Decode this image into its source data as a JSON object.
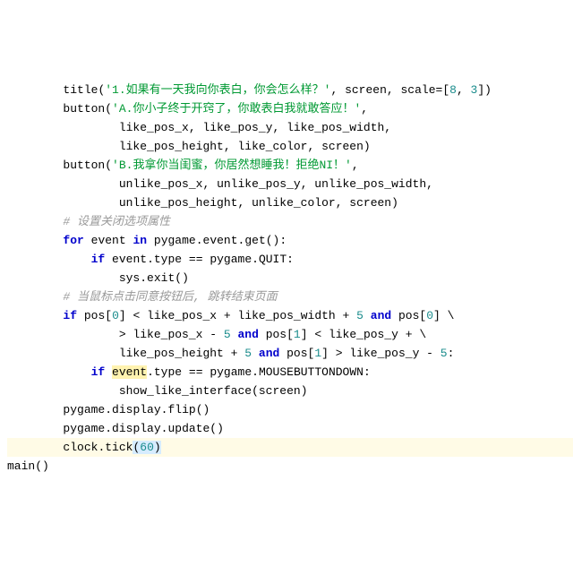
{
  "indent": "    ",
  "lines": [
    {
      "lvl": 2,
      "segs": [
        {
          "t": "fn",
          "v": "title"
        },
        {
          "t": "op",
          "v": "("
        },
        {
          "t": "str",
          "v": "'1.如果有一天我向你表白，你会怎么样？'"
        },
        {
          "t": "op",
          "v": ", "
        },
        {
          "t": "fn",
          "v": "screen"
        },
        {
          "t": "op",
          "v": ", "
        },
        {
          "t": "fn",
          "v": "scale"
        },
        {
          "t": "op",
          "v": "=["
        },
        {
          "t": "num",
          "v": "8"
        },
        {
          "t": "op",
          "v": ", "
        },
        {
          "t": "num",
          "v": "3"
        },
        {
          "t": "op",
          "v": "])"
        }
      ]
    },
    {
      "lvl": 2,
      "segs": [
        {
          "t": "fn",
          "v": "button"
        },
        {
          "t": "op",
          "v": "("
        },
        {
          "t": "str",
          "v": "'A.你小子终于开窍了，你敢表白我就敢答应！'"
        },
        {
          "t": "op",
          "v": ","
        }
      ]
    },
    {
      "lvl": 4,
      "segs": [
        {
          "t": "fn",
          "v": "like_pos_x"
        },
        {
          "t": "op",
          "v": ", "
        },
        {
          "t": "fn",
          "v": "like_pos_y"
        },
        {
          "t": "op",
          "v": ", "
        },
        {
          "t": "fn",
          "v": "like_pos_width"
        },
        {
          "t": "op",
          "v": ","
        }
      ]
    },
    {
      "lvl": 4,
      "segs": [
        {
          "t": "fn",
          "v": "like_pos_height"
        },
        {
          "t": "op",
          "v": ", "
        },
        {
          "t": "fn",
          "v": "like_color"
        },
        {
          "t": "op",
          "v": ", "
        },
        {
          "t": "fn",
          "v": "screen"
        },
        {
          "t": "op",
          "v": ")"
        }
      ]
    },
    {
      "lvl": 2,
      "segs": [
        {
          "t": "fn",
          "v": "button"
        },
        {
          "t": "op",
          "v": "("
        },
        {
          "t": "str",
          "v": "'B.我拿你当闺蜜，你居然想睡我！拒绝NI！'"
        },
        {
          "t": "op",
          "v": ","
        }
      ]
    },
    {
      "lvl": 4,
      "segs": [
        {
          "t": "fn",
          "v": "unlike_pos_x"
        },
        {
          "t": "op",
          "v": ", "
        },
        {
          "t": "fn",
          "v": "unlike_pos_y"
        },
        {
          "t": "op",
          "v": ", "
        },
        {
          "t": "fn",
          "v": "unlike_pos_width"
        },
        {
          "t": "op",
          "v": ","
        }
      ]
    },
    {
      "lvl": 4,
      "segs": [
        {
          "t": "fn",
          "v": "unlike_pos_height"
        },
        {
          "t": "op",
          "v": ", "
        },
        {
          "t": "fn",
          "v": "unlike_color"
        },
        {
          "t": "op",
          "v": ", "
        },
        {
          "t": "fn",
          "v": "screen"
        },
        {
          "t": "op",
          "v": ")"
        }
      ]
    },
    {
      "lvl": 2,
      "segs": [
        {
          "t": "comm",
          "v": "# 设置关闭选项属性"
        }
      ]
    },
    {
      "lvl": 2,
      "segs": [
        {
          "t": "kw",
          "v": "for"
        },
        {
          "t": "op",
          "v": " "
        },
        {
          "t": "fn",
          "v": "event"
        },
        {
          "t": "op",
          "v": " "
        },
        {
          "t": "kw",
          "v": "in"
        },
        {
          "t": "op",
          "v": " "
        },
        {
          "t": "fn",
          "v": "pygame"
        },
        {
          "t": "op",
          "v": "."
        },
        {
          "t": "fn",
          "v": "event"
        },
        {
          "t": "op",
          "v": "."
        },
        {
          "t": "fn",
          "v": "get"
        },
        {
          "t": "op",
          "v": "():"
        }
      ]
    },
    {
      "lvl": 3,
      "segs": [
        {
          "t": "kw",
          "v": "if"
        },
        {
          "t": "op",
          "v": " "
        },
        {
          "t": "fn",
          "v": "event"
        },
        {
          "t": "op",
          "v": "."
        },
        {
          "t": "fn",
          "v": "type"
        },
        {
          "t": "op",
          "v": " == "
        },
        {
          "t": "fn",
          "v": "pygame"
        },
        {
          "t": "op",
          "v": "."
        },
        {
          "t": "fn",
          "v": "QUIT"
        },
        {
          "t": "op",
          "v": ":"
        }
      ]
    },
    {
      "lvl": 4,
      "segs": [
        {
          "t": "fn",
          "v": "sys"
        },
        {
          "t": "op",
          "v": "."
        },
        {
          "t": "fn",
          "v": "exit"
        },
        {
          "t": "op",
          "v": "()"
        }
      ]
    },
    {
      "lvl": 2,
      "segs": [
        {
          "t": "comm",
          "v": "# 当鼠标点击同意按钮后, 跳转结束页面"
        }
      ]
    },
    {
      "lvl": 2,
      "segs": [
        {
          "t": "kw",
          "v": "if"
        },
        {
          "t": "op",
          "v": " "
        },
        {
          "t": "fn",
          "v": "pos"
        },
        {
          "t": "op",
          "v": "["
        },
        {
          "t": "num",
          "v": "0"
        },
        {
          "t": "op",
          "v": "] < "
        },
        {
          "t": "fn",
          "v": "like_pos_x"
        },
        {
          "t": "op",
          "v": " + "
        },
        {
          "t": "fn",
          "v": "like_pos_width"
        },
        {
          "t": "op",
          "v": " + "
        },
        {
          "t": "num",
          "v": "5"
        },
        {
          "t": "op",
          "v": " "
        },
        {
          "t": "kw",
          "v": "and"
        },
        {
          "t": "op",
          "v": " "
        },
        {
          "t": "fn",
          "v": "pos"
        },
        {
          "t": "op",
          "v": "["
        },
        {
          "t": "num",
          "v": "0"
        },
        {
          "t": "op",
          "v": "] \\"
        }
      ]
    },
    {
      "lvl": 4,
      "segs": [
        {
          "t": "op",
          "v": "> "
        },
        {
          "t": "fn",
          "v": "like_pos_x"
        },
        {
          "t": "op",
          "v": " - "
        },
        {
          "t": "num",
          "v": "5"
        },
        {
          "t": "op",
          "v": " "
        },
        {
          "t": "kw",
          "v": "and"
        },
        {
          "t": "op",
          "v": " "
        },
        {
          "t": "fn",
          "v": "pos"
        },
        {
          "t": "op",
          "v": "["
        },
        {
          "t": "num",
          "v": "1"
        },
        {
          "t": "op",
          "v": "] < "
        },
        {
          "t": "fn",
          "v": "like_pos_y"
        },
        {
          "t": "op",
          "v": " + \\"
        }
      ]
    },
    {
      "lvl": 4,
      "segs": [
        {
          "t": "fn",
          "v": "like_pos_height"
        },
        {
          "t": "op",
          "v": " + "
        },
        {
          "t": "num",
          "v": "5"
        },
        {
          "t": "op",
          "v": " "
        },
        {
          "t": "kw",
          "v": "and"
        },
        {
          "t": "op",
          "v": " "
        },
        {
          "t": "fn",
          "v": "pos"
        },
        {
          "t": "op",
          "v": "["
        },
        {
          "t": "num",
          "v": "1"
        },
        {
          "t": "op",
          "v": "] > "
        },
        {
          "t": "fn",
          "v": "like_pos_y"
        },
        {
          "t": "op",
          "v": " - "
        },
        {
          "t": "num",
          "v": "5"
        },
        {
          "t": "op",
          "v": ":"
        }
      ]
    },
    {
      "lvl": 3,
      "segs": [
        {
          "t": "kw",
          "v": "if"
        },
        {
          "t": "op",
          "v": " "
        },
        {
          "t": "fn",
          "v": "event",
          "hl": "event"
        },
        {
          "t": "op",
          "v": "."
        },
        {
          "t": "fn",
          "v": "type"
        },
        {
          "t": "op",
          "v": " == "
        },
        {
          "t": "fn",
          "v": "pygame"
        },
        {
          "t": "op",
          "v": "."
        },
        {
          "t": "fn",
          "v": "MOUSEBUTTONDOWN"
        },
        {
          "t": "op",
          "v": ":"
        }
      ]
    },
    {
      "lvl": 4,
      "segs": [
        {
          "t": "fn",
          "v": "show_like_interface"
        },
        {
          "t": "op",
          "v": "("
        },
        {
          "t": "fn",
          "v": "screen"
        },
        {
          "t": "op",
          "v": ")"
        }
      ]
    },
    {
      "lvl": 0,
      "segs": [
        {
          "t": "op",
          "v": ""
        }
      ]
    },
    {
      "lvl": 2,
      "segs": [
        {
          "t": "fn",
          "v": "pygame"
        },
        {
          "t": "op",
          "v": "."
        },
        {
          "t": "fn",
          "v": "display"
        },
        {
          "t": "op",
          "v": "."
        },
        {
          "t": "fn",
          "v": "flip"
        },
        {
          "t": "op",
          "v": "()"
        }
      ]
    },
    {
      "lvl": 2,
      "segs": [
        {
          "t": "fn",
          "v": "pygame"
        },
        {
          "t": "op",
          "v": "."
        },
        {
          "t": "fn",
          "v": "display"
        },
        {
          "t": "op",
          "v": "."
        },
        {
          "t": "fn",
          "v": "update"
        },
        {
          "t": "op",
          "v": "()"
        }
      ]
    },
    {
      "lvl": 2,
      "cur": true,
      "segs": [
        {
          "t": "fn",
          "v": "clock"
        },
        {
          "t": "op",
          "v": "."
        },
        {
          "t": "fn",
          "v": "tick"
        },
        {
          "t": "op",
          "v": "(",
          "hl": "arg"
        },
        {
          "t": "num",
          "v": "60",
          "hl": "arg"
        },
        {
          "t": "op",
          "v": ")",
          "hl": "arg"
        }
      ]
    },
    {
      "lvl": 0,
      "segs": [
        {
          "t": "fn",
          "v": "main"
        },
        {
          "t": "op",
          "v": "()"
        }
      ]
    }
  ]
}
